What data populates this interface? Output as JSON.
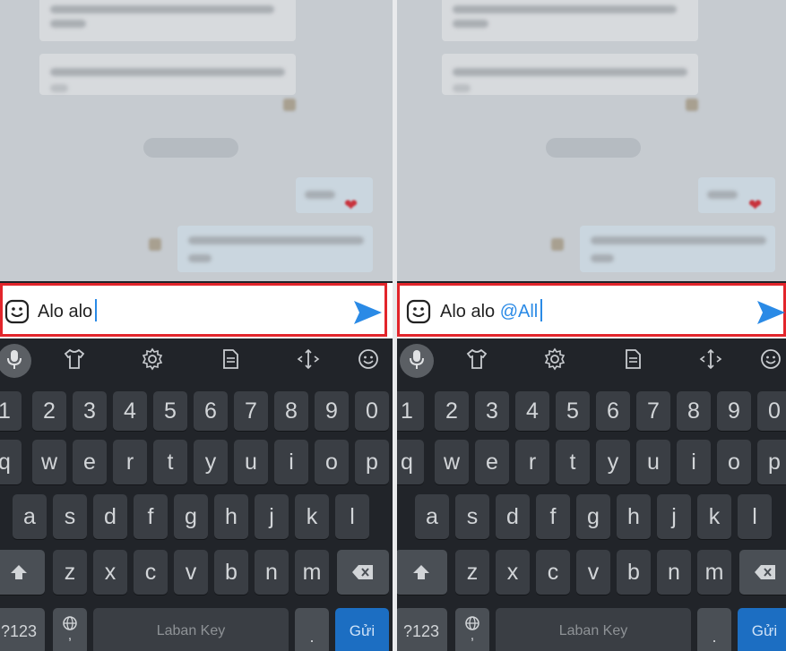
{
  "left": {
    "message_text": "Alo alo",
    "mention": ""
  },
  "right": {
    "message_text": "Alo alo",
    "mention": "@All"
  },
  "keyboard": {
    "number_row": [
      "1",
      "2",
      "3",
      "4",
      "5",
      "6",
      "7",
      "8",
      "9",
      "0"
    ],
    "row1": [
      "q",
      "w",
      "e",
      "r",
      "t",
      "y",
      "u",
      "i",
      "o",
      "p"
    ],
    "row2": [
      "a",
      "s",
      "d",
      "f",
      "g",
      "h",
      "j",
      "k",
      "l"
    ],
    "row3": [
      "z",
      "x",
      "c",
      "v",
      "b",
      "n",
      "m"
    ],
    "symbols_label": "?123",
    "space_label": "Laban Key",
    "period_label": ".",
    "comma_label": ",",
    "send_label": "Gửi"
  },
  "toolbar_icons": [
    "mic-icon",
    "shirt-icon",
    "settings-icon",
    "clipboard-icon",
    "cursor-move-icon",
    "emoji-icon"
  ],
  "colors": {
    "highlight_border": "#e2252b",
    "send_arrow": "#2a8ae6",
    "mention": "#2a8ae6",
    "keyboard_bg": "#212429",
    "key_bg": "#3a3e44",
    "send_key": "#1c6ec2"
  }
}
